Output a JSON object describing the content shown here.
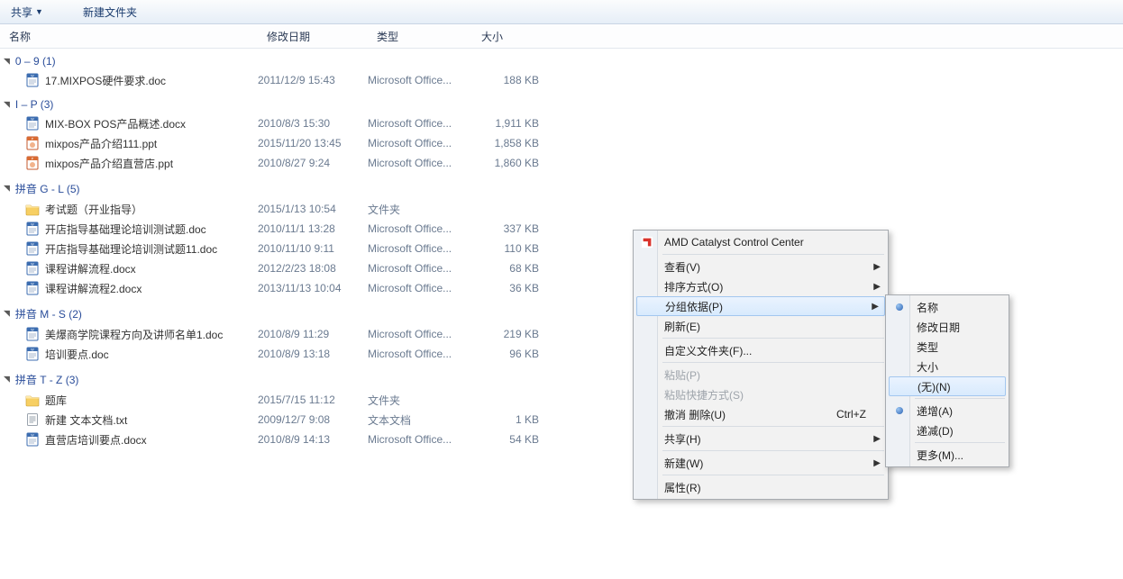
{
  "toolbar": {
    "share": "共享",
    "new_folder": "新建文件夹"
  },
  "columns": {
    "name": "名称",
    "date": "修改日期",
    "type": "类型",
    "size": "大小"
  },
  "type_office": "Microsoft Office...",
  "type_folder": "文件夹",
  "type_txt": "文本文档",
  "groups": [
    {
      "label": "0 – 9 (1)",
      "files": [
        {
          "icon": "doc",
          "name": "17.MIXPOS硬件要求.doc",
          "date": "2011/12/9 15:43",
          "type": "Microsoft Office...",
          "size": "188 KB"
        }
      ]
    },
    {
      "label": "I – P (3)",
      "files": [
        {
          "icon": "docx",
          "name": "MIX-BOX POS产品概述.docx",
          "date": "2010/8/3 15:30",
          "type": "Microsoft Office...",
          "size": "1,911 KB"
        },
        {
          "icon": "ppt",
          "name": "mixpos产品介绍111.ppt",
          "date": "2015/11/20 13:45",
          "type": "Microsoft Office...",
          "size": "1,858 KB"
        },
        {
          "icon": "ppt",
          "name": "mixpos产品介绍直营店.ppt",
          "date": "2010/8/27 9:24",
          "type": "Microsoft Office...",
          "size": "1,860 KB"
        }
      ]
    },
    {
      "label": "拼音 G - L (5)",
      "files": [
        {
          "icon": "folder",
          "name": "考试题（开业指导）",
          "date": "2015/1/13 10:54",
          "type": "文件夹",
          "size": ""
        },
        {
          "icon": "doc",
          "name": "开店指导基础理论培训测试题.doc",
          "date": "2010/11/1 13:28",
          "type": "Microsoft Office...",
          "size": "337 KB"
        },
        {
          "icon": "doc",
          "name": "开店指导基础理论培训测试题11.doc",
          "date": "2010/11/10 9:11",
          "type": "Microsoft Office...",
          "size": "110 KB"
        },
        {
          "icon": "docx",
          "name": "课程讲解流程.docx",
          "date": "2012/2/23 18:08",
          "type": "Microsoft Office...",
          "size": "68 KB"
        },
        {
          "icon": "docx",
          "name": "课程讲解流程2.docx",
          "date": "2013/11/13 10:04",
          "type": "Microsoft Office...",
          "size": "36 KB"
        }
      ]
    },
    {
      "label": "拼音 M - S (2)",
      "files": [
        {
          "icon": "doc",
          "name": "美爆商学院课程方向及讲师名单1.doc",
          "date": "2010/8/9 11:29",
          "type": "Microsoft Office...",
          "size": "219 KB"
        },
        {
          "icon": "doc",
          "name": "培训要点.doc",
          "date": "2010/8/9 13:18",
          "type": "Microsoft Office...",
          "size": "96 KB"
        }
      ]
    },
    {
      "label": "拼音 T - Z (3)",
      "files": [
        {
          "icon": "folder",
          "name": "题库",
          "date": "2015/7/15 11:12",
          "type": "文件夹",
          "size": ""
        },
        {
          "icon": "txt",
          "name": "新建 文本文档.txt",
          "date": "2009/12/7 9:08",
          "type": "文本文档",
          "size": "1 KB"
        },
        {
          "icon": "docx",
          "name": "直营店培训要点.docx",
          "date": "2010/8/9 14:13",
          "type": "Microsoft Office...",
          "size": "54 KB"
        }
      ]
    }
  ],
  "ctx1": {
    "items": [
      {
        "kind": "item",
        "key": "amd",
        "label": "AMD Catalyst Control Center",
        "icon": "amd"
      },
      {
        "kind": "sep"
      },
      {
        "kind": "item",
        "key": "view",
        "label": "查看(V)",
        "sub": true
      },
      {
        "kind": "item",
        "key": "sort",
        "label": "排序方式(O)",
        "sub": true
      },
      {
        "kind": "item",
        "key": "group",
        "label": "分组依据(P)",
        "sub": true,
        "highlight": true
      },
      {
        "kind": "item",
        "key": "refresh",
        "label": "刷新(E)"
      },
      {
        "kind": "sep"
      },
      {
        "kind": "item",
        "key": "customize",
        "label": "自定义文件夹(F)..."
      },
      {
        "kind": "sep"
      },
      {
        "kind": "item",
        "key": "paste",
        "label": "粘贴(P)",
        "disabled": true
      },
      {
        "kind": "item",
        "key": "paste-link",
        "label": "粘贴快捷方式(S)",
        "disabled": true
      },
      {
        "kind": "item",
        "key": "undo",
        "label": "撤消 删除(U)",
        "shortcut": "Ctrl+Z"
      },
      {
        "kind": "sep"
      },
      {
        "kind": "item",
        "key": "share",
        "label": "共享(H)",
        "sub": true
      },
      {
        "kind": "sep"
      },
      {
        "kind": "item",
        "key": "new",
        "label": "新建(W)",
        "sub": true
      },
      {
        "kind": "sep"
      },
      {
        "kind": "item",
        "key": "properties",
        "label": "属性(R)"
      }
    ]
  },
  "ctx2": {
    "items": [
      {
        "kind": "item",
        "key": "by-name",
        "label": "名称",
        "radio": true
      },
      {
        "kind": "item",
        "key": "by-date",
        "label": "修改日期"
      },
      {
        "kind": "item",
        "key": "by-type",
        "label": "类型"
      },
      {
        "kind": "item",
        "key": "by-size",
        "label": "大小"
      },
      {
        "kind": "item",
        "key": "none",
        "label": "(无)(N)",
        "highlight": true
      },
      {
        "kind": "sep"
      },
      {
        "kind": "item",
        "key": "asc",
        "label": "递增(A)",
        "radio": true
      },
      {
        "kind": "item",
        "key": "desc",
        "label": "递减(D)"
      },
      {
        "kind": "sep"
      },
      {
        "kind": "item",
        "key": "more",
        "label": "更多(M)..."
      }
    ]
  }
}
